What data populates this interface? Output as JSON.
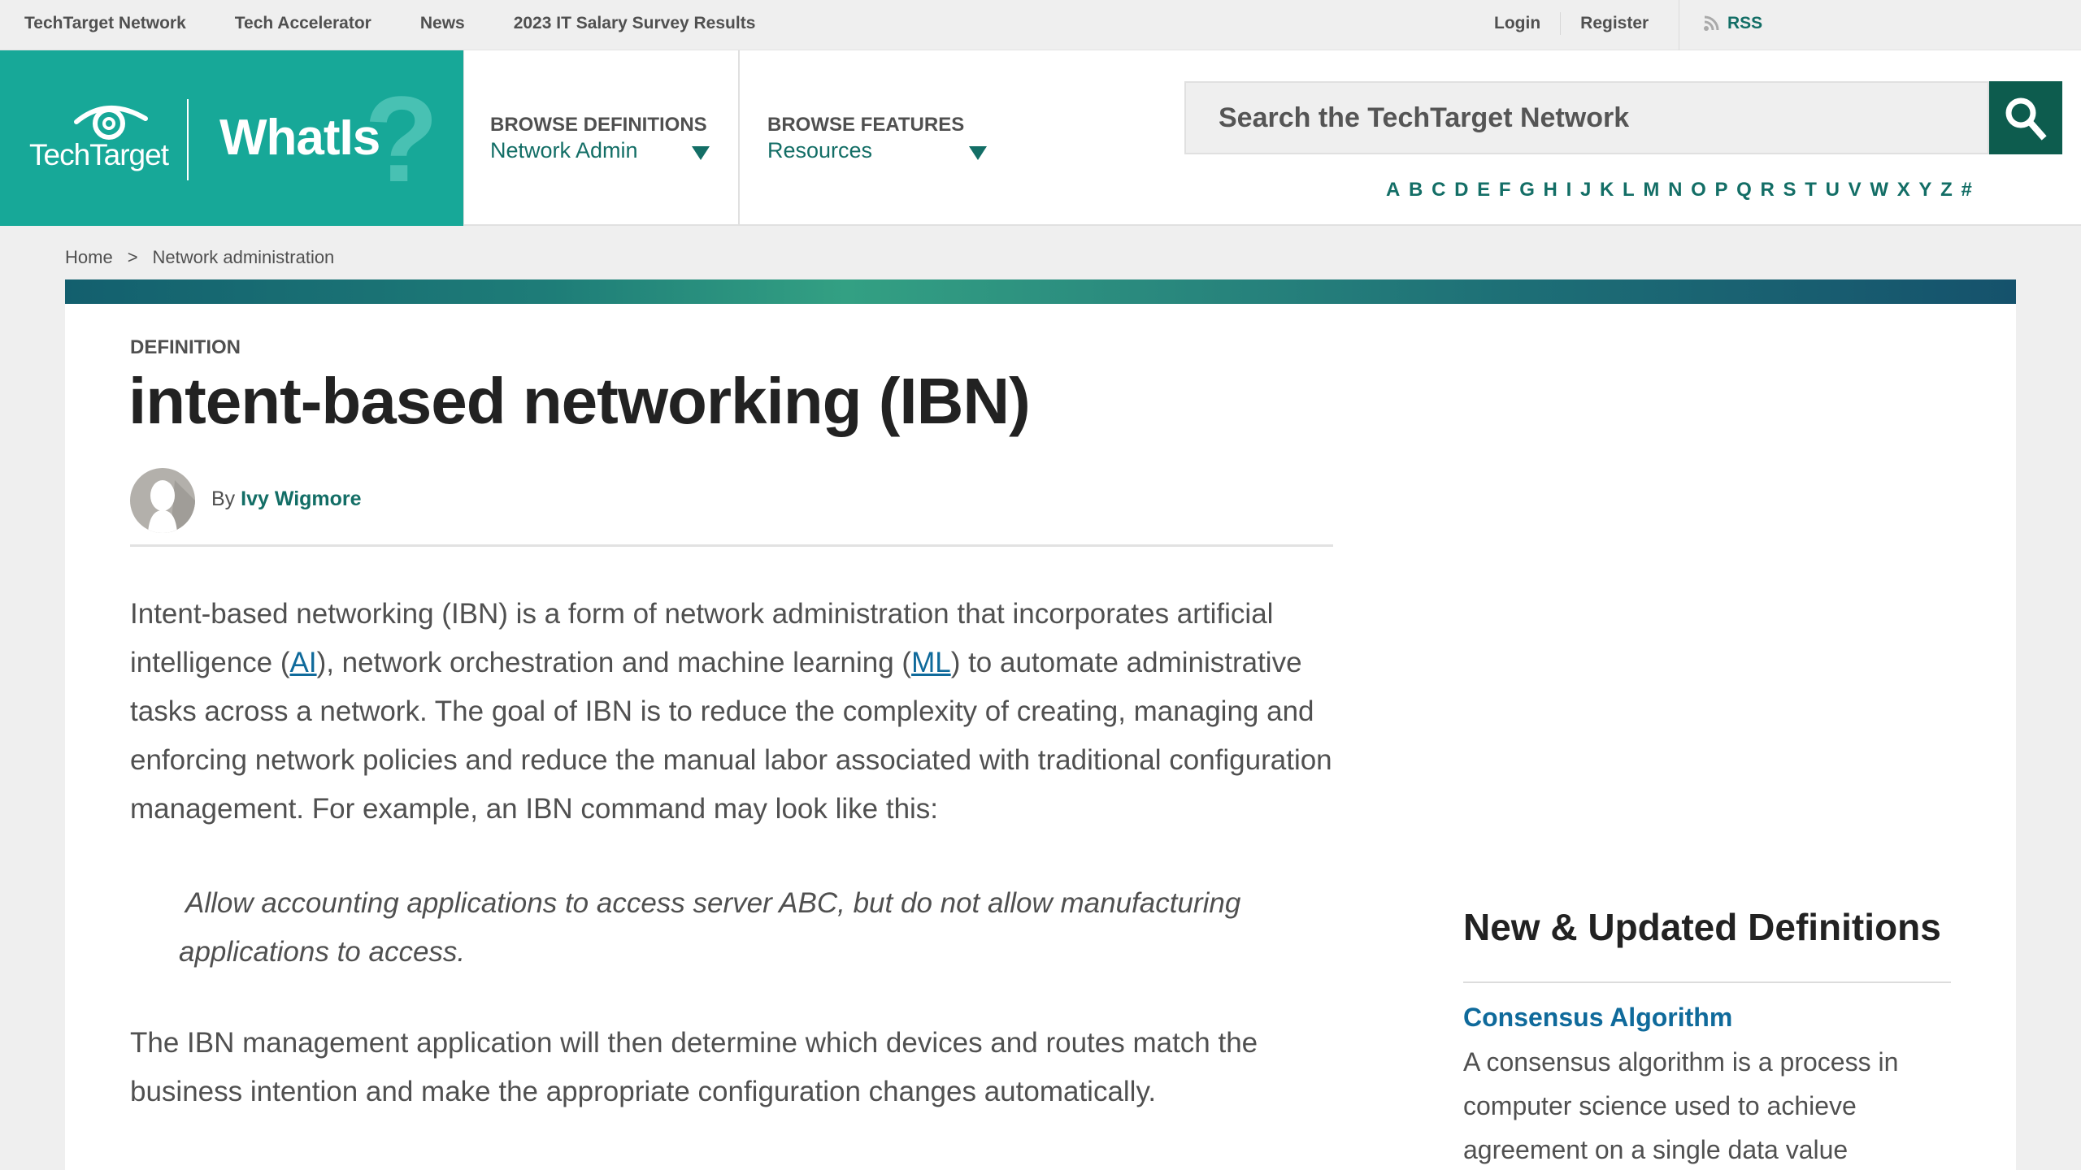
{
  "topbar": {
    "links": [
      "TechTarget Network",
      "Tech Accelerator",
      "News",
      "2023 IT Salary Survey Results"
    ],
    "login": "Login",
    "register": "Register",
    "rss": "RSS"
  },
  "header": {
    "brand": "TechTarget",
    "site": "WhatIs",
    "site_mark": "?",
    "browse_definitions": {
      "title": "BROWSE DEFINITIONS",
      "value": "Network Admin"
    },
    "browse_features": {
      "title": "BROWSE FEATURES",
      "value": "Resources"
    },
    "search": {
      "placeholder": "Search the TechTarget Network"
    },
    "alphabet": [
      "A",
      "B",
      "C",
      "D",
      "E",
      "F",
      "G",
      "H",
      "I",
      "J",
      "K",
      "L",
      "M",
      "N",
      "O",
      "P",
      "Q",
      "R",
      "S",
      "T",
      "U",
      "V",
      "W",
      "X",
      "Y",
      "Z",
      "#"
    ]
  },
  "breadcrumb": {
    "home": "Home",
    "separator": ">",
    "current": "Network administration"
  },
  "article": {
    "kicker": "DEFINITION",
    "title": "intent-based networking (IBN)",
    "by": "By",
    "author": "Ivy Wigmore",
    "p1_a": "Intent-based networking (IBN) is a form of network administration that incorporates artificial intelligence (",
    "p1_link1": "AI",
    "p1_b": "), network orchestration and machine learning (",
    "p1_link2": "ML",
    "p1_c": ") to automate administrative tasks across a network. The goal of IBN is to reduce the complexity of creating, managing and enforcing network policies and reduce the manual labor associated with traditional configuration management. For example, an IBN command may look like this:",
    "quote_line1": "Allow accounting applications to access server ABC, but do not allow manufacturing",
    "quote_line2": "applications to access.",
    "p2": "The IBN management application will then determine which devices and routes match the business intention and make the appropriate configuration changes automatically."
  },
  "sidebar": {
    "title": "New & Updated Definitions",
    "items": [
      {
        "title": "Consensus Algorithm",
        "desc": "A consensus algorithm is a process in computer science used to achieve agreement on a single data value"
      }
    ]
  },
  "colors": {
    "brand_teal": "#17a898",
    "link_green": "#136e66",
    "link_blue": "#0f6a9b",
    "search_button": "#0d5c4e"
  }
}
